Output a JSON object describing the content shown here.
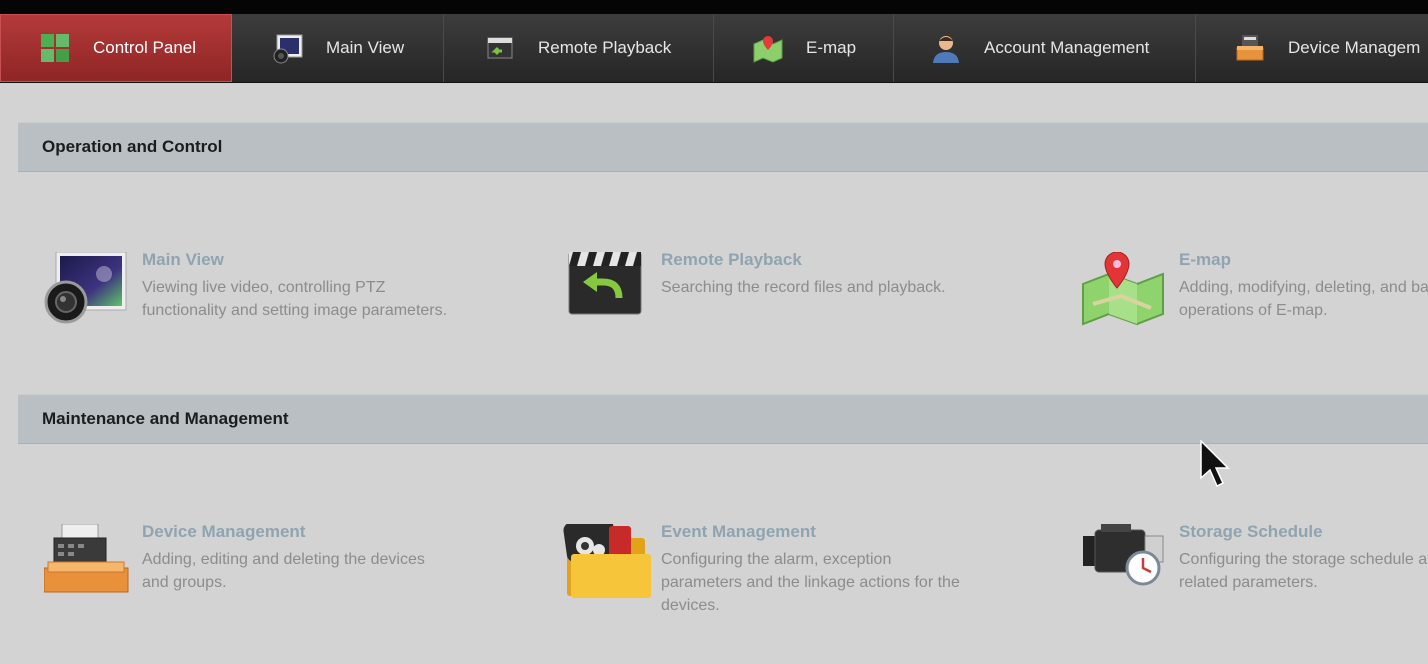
{
  "tabs": [
    {
      "label": "Control Panel",
      "icon": "grid-icon",
      "active": true
    },
    {
      "label": "Main View",
      "icon": "monitor-camera-icon"
    },
    {
      "label": "Remote Playback",
      "icon": "clapperboard-icon"
    },
    {
      "label": "E-map",
      "icon": "map-pin-icon"
    },
    {
      "label": "Account Management",
      "icon": "user-icon"
    },
    {
      "label": "Device Managem",
      "icon": "device-tray-icon"
    }
  ],
  "sections": {
    "operation": {
      "title": "Operation and Control",
      "items": [
        {
          "title": "Main View",
          "desc": "Viewing live video, controlling PTZ functionality and setting image parameters.",
          "icon": "monitor-camera-icon"
        },
        {
          "title": "Remote Playback",
          "desc": "Searching the record files and playback.",
          "icon": "clapperboard-icon"
        },
        {
          "title": "E-map",
          "desc": "Adding, modifying, deleting, and basic operations of E-map.",
          "icon": "map-pin-icon"
        }
      ]
    },
    "maintenance": {
      "title": "Maintenance and Management",
      "items": [
        {
          "title": "Device Management",
          "desc": "Adding, editing and deleting the devices and groups.",
          "icon": "device-tray-icon"
        },
        {
          "title": "Event Management",
          "desc": "Configuring the alarm, exception parameters and the linkage actions for the devices.",
          "icon": "event-folder-icon"
        },
        {
          "title": "Storage Schedule",
          "desc": "Configuring the storage schedule and related parameters.",
          "icon": "camcorder-clock-icon"
        }
      ]
    }
  },
  "colors": {
    "active_tab": "#a32e2e",
    "section_bg": "#b9bfc3",
    "link": "#8fa4b0",
    "desc": "#8c8c8c"
  }
}
